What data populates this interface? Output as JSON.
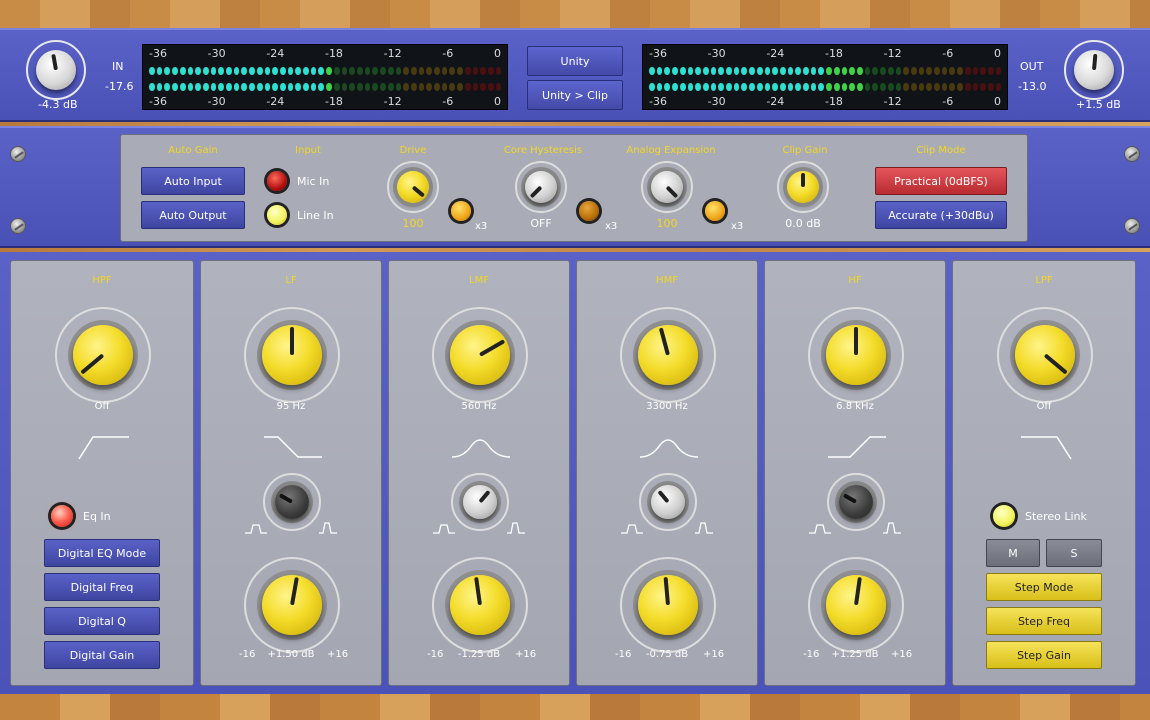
{
  "meters": {
    "in_label": "IN",
    "in_level": "-17.6",
    "out_label": "OUT",
    "out_level": "-13.0",
    "scale": [
      "-36",
      "-30",
      "-24",
      "-18",
      "-12",
      "-6",
      "0"
    ]
  },
  "in_knob": {
    "value": "-4.3 dB"
  },
  "out_knob": {
    "value": "+1.5 dB"
  },
  "unity_button": "Unity",
  "unity_clip_button": "Unity > Clip",
  "controls": {
    "auto_gain_label": "Auto Gain",
    "auto_input": "Auto Input",
    "auto_output": "Auto Output",
    "input_label": "Input",
    "mic_in": "Mic In",
    "line_in": "Line In",
    "drive_label": "Drive",
    "drive_value": "100",
    "drive_mult": "x3",
    "core_label": "Core Hysteresis",
    "core_value": "OFF",
    "core_mult": "x3",
    "analog_label": "Analog Expansion",
    "analog_value": "100",
    "analog_mult": "x3",
    "clip_gain_label": "Clip Gain",
    "clip_gain_value": "0.0 dB",
    "clip_mode_label": "Clip Mode",
    "practical": "Practical (0dBFS)",
    "accurate": "Accurate (+30dBu)"
  },
  "hpf": {
    "title": "HPF",
    "value": "Off",
    "eq_in": "Eq In",
    "buttons": [
      "Digital EQ Mode",
      "Digital Freq",
      "Digital Q",
      "Digital Gain"
    ]
  },
  "bands": [
    {
      "title": "LF",
      "freq": "95 Hz",
      "gain": "+1.50 dB",
      "min": "-16",
      "max": "+16"
    },
    {
      "title": "LMF",
      "freq": "560 Hz",
      "gain": "-1.25 dB",
      "min": "-16",
      "max": "+16"
    },
    {
      "title": "HMF",
      "freq": "3300 Hz",
      "gain": "-0.75 dB",
      "min": "-16",
      "max": "+16"
    },
    {
      "title": "HF",
      "freq": "6.8 kHz",
      "gain": "+1.25 dB",
      "min": "-16",
      "max": "+16"
    }
  ],
  "lpf": {
    "title": "LPF",
    "value": "Off",
    "stereo_link": "Stereo Link",
    "m": "M",
    "s": "S",
    "buttons": [
      "Step Mode",
      "Step Freq",
      "Step Gain"
    ]
  },
  "colors": {
    "accent_yellow": "#f4d622",
    "rack_blue": "#5058c0",
    "panel_gray": "#a9acb6"
  }
}
